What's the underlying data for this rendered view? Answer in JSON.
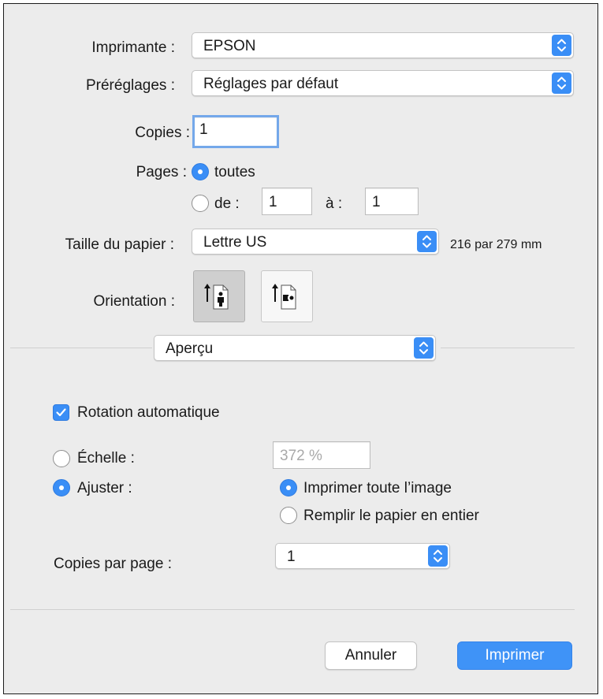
{
  "printer": {
    "label": "Imprimante :",
    "value": "EPSON"
  },
  "presets": {
    "label": "Préréglages :",
    "value": "Réglages par défaut"
  },
  "copies": {
    "label": "Copies :",
    "value": "1"
  },
  "pages": {
    "label": "Pages :",
    "all_label": "toutes",
    "range_from_label": "de :",
    "range_from_value": "1",
    "range_to_label": "à :",
    "range_to_value": "1",
    "selected": "all"
  },
  "paper_size": {
    "label": "Taille du papier :",
    "value": "Lettre US",
    "dimensions": "216 par 279 mm"
  },
  "orientation": {
    "label": "Orientation :",
    "selected": "portrait",
    "icons": [
      "portrait-orientation-icon",
      "landscape-orientation-icon"
    ]
  },
  "section": {
    "value": "Aperçu"
  },
  "preview": {
    "auto_rotate_label": "Rotation automatique",
    "auto_rotate_checked": true,
    "scale_label": "Échelle :",
    "scale_value": "372 %",
    "fit_label": "Ajuster :",
    "fit_selected": true,
    "print_entire_label": "Imprimer toute l’image",
    "fill_paper_label": "Remplir le papier en entier",
    "fit_mode": "print_entire",
    "copies_per_page_label": "Copies par page :",
    "copies_per_page_value": "1"
  },
  "buttons": {
    "cancel": "Annuler",
    "print": "Imprimer"
  },
  "colors": {
    "accent": "#3a8ef6",
    "background": "#ececec",
    "separator": "#d0d0d0"
  }
}
